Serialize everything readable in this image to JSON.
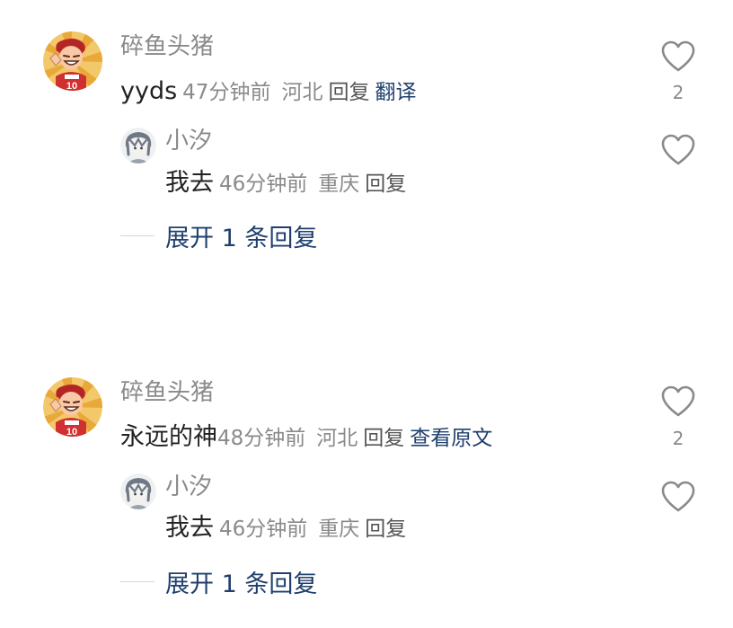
{
  "colors": {
    "meta_gray": "#8a8a8a",
    "text_dark": "#222222",
    "link_blue": "#1f3f6e"
  },
  "threads": [
    {
      "comment": {
        "username": "碎鱼头猪",
        "text": "yyds",
        "time": "47分钟前",
        "location": "河北",
        "reply_label": "回复",
        "translate_label": "翻译",
        "like_count": "2",
        "avatar_icon": "cartoon-player-avatar"
      },
      "reply": {
        "username": "小汐",
        "text": "我去",
        "time": "46分钟前",
        "location": "重庆",
        "reply_label": "回复",
        "avatar_icon": "anime-character-avatar"
      },
      "expand_label": "展开 1 条回复"
    },
    {
      "comment": {
        "username": "碎鱼头猪",
        "text": "永远的神",
        "time": "48分钟前",
        "location": "河北",
        "reply_label": "回复",
        "translate_label": "查看原文",
        "like_count": "2",
        "avatar_icon": "cartoon-player-avatar"
      },
      "reply": {
        "username": "小汐",
        "text": "我去",
        "time": "46分钟前",
        "location": "重庆",
        "reply_label": "回复",
        "avatar_icon": "anime-character-avatar"
      },
      "expand_label": "展开 1 条回复"
    }
  ]
}
